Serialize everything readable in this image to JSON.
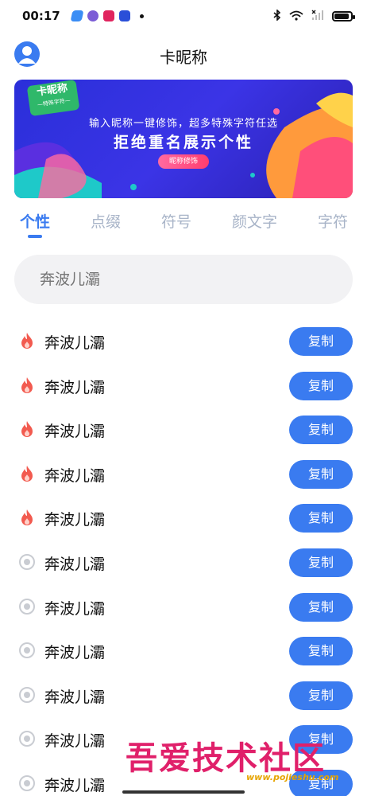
{
  "status_bar": {
    "time": "00:17",
    "apps": [
      {
        "name": "app-a-icon",
        "color": "#3a8df5"
      },
      {
        "name": "app-b-icon",
        "color": "#7b5cd6"
      },
      {
        "name": "app-c-icon",
        "color": "#e0245e"
      },
      {
        "name": "app-d-icon",
        "color": "#2a4fd8"
      }
    ],
    "battery_level": 0.9
  },
  "header": {
    "title": "卡昵称"
  },
  "banner": {
    "badge_title": "卡昵称",
    "badge_subtitle": "—特殊字符—",
    "line1": "输入昵称一键修饰，超多特殊字符任选",
    "line2": "拒绝重名展示个性",
    "button_label": "昵称修饰"
  },
  "tabs": [
    {
      "label": "个性",
      "active": true
    },
    {
      "label": "点缀",
      "active": false
    },
    {
      "label": "符号",
      "active": false
    },
    {
      "label": "颜文字",
      "active": false
    },
    {
      "label": "字符",
      "active": false
    }
  ],
  "search": {
    "value": "奔波儿灞",
    "placeholder": "奔波儿灞"
  },
  "items": [
    {
      "text": "奔波儿灞",
      "icon": "fire-icon",
      "button": "复制"
    },
    {
      "text": "奔波儿灞",
      "icon": "fire-icon",
      "button": "复制"
    },
    {
      "text": "奔波儿灞",
      "icon": "fire-icon",
      "button": "复制"
    },
    {
      "text": "奔波儿灞",
      "icon": "fire-icon",
      "button": "复制"
    },
    {
      "text": "奔波儿灞",
      "icon": "fire-icon",
      "button": "复制"
    },
    {
      "text": "奔波儿灞",
      "icon": "radio-dot-icon",
      "button": "复制"
    },
    {
      "text": "奔波儿灞",
      "icon": "radio-dot-icon",
      "button": "复制"
    },
    {
      "text": "奔波儿灞",
      "icon": "radio-dot-icon",
      "button": "复制"
    },
    {
      "text": "奔波儿灞",
      "icon": "radio-dot-icon",
      "button": "复制"
    },
    {
      "text": "奔波儿灞",
      "icon": "radio-dot-icon",
      "button": "复制"
    },
    {
      "text": "奔波儿灞",
      "icon": "radio-dot-icon",
      "button": "复制"
    }
  ],
  "watermark": {
    "title": "吾爱技术社区",
    "url": "www.pojieshu.com"
  },
  "colors": {
    "accent": "#3a7bf0",
    "fire": "#f25a4f",
    "muted": "#c9ccd2"
  }
}
